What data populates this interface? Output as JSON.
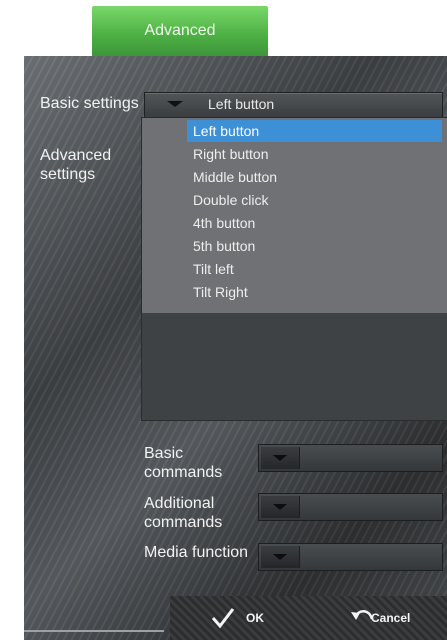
{
  "tab": {
    "label": "Advanced"
  },
  "nav": {
    "basic": "Basic settings",
    "advanced": "Advanced settings"
  },
  "button_select": {
    "value": "Left button",
    "options": [
      "Left button",
      "Right button",
      "Middle button",
      "Double click",
      "4th button",
      "5th button",
      "Tilt left",
      "Tilt Right"
    ],
    "selected_index": 0
  },
  "commands": [
    {
      "label": "Basic commands"
    },
    {
      "label": "Additional commands"
    },
    {
      "label": "Media function"
    }
  ],
  "footer": {
    "ok_label": "OK",
    "cancel_label": "Cancel"
  },
  "colors": {
    "tab": "#4caf43",
    "highlight": "#3d8fd6"
  }
}
